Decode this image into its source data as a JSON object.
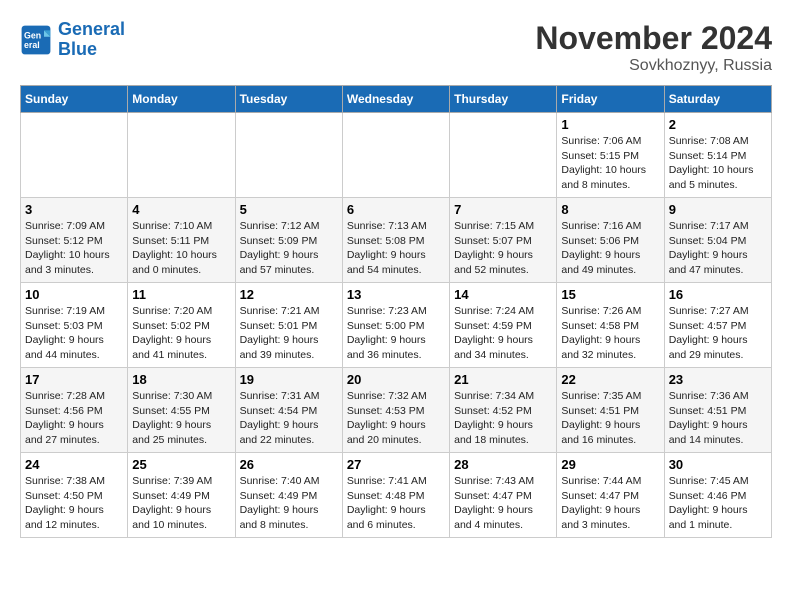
{
  "header": {
    "logo_line1": "General",
    "logo_line2": "Blue",
    "month": "November 2024",
    "location": "Sovkhoznyy, Russia"
  },
  "weekdays": [
    "Sunday",
    "Monday",
    "Tuesday",
    "Wednesday",
    "Thursday",
    "Friday",
    "Saturday"
  ],
  "weeks": [
    [
      {
        "day": "",
        "info": ""
      },
      {
        "day": "",
        "info": ""
      },
      {
        "day": "",
        "info": ""
      },
      {
        "day": "",
        "info": ""
      },
      {
        "day": "",
        "info": ""
      },
      {
        "day": "1",
        "info": "Sunrise: 7:06 AM\nSunset: 5:15 PM\nDaylight: 10 hours\nand 8 minutes."
      },
      {
        "day": "2",
        "info": "Sunrise: 7:08 AM\nSunset: 5:14 PM\nDaylight: 10 hours\nand 5 minutes."
      }
    ],
    [
      {
        "day": "3",
        "info": "Sunrise: 7:09 AM\nSunset: 5:12 PM\nDaylight: 10 hours\nand 3 minutes."
      },
      {
        "day": "4",
        "info": "Sunrise: 7:10 AM\nSunset: 5:11 PM\nDaylight: 10 hours\nand 0 minutes."
      },
      {
        "day": "5",
        "info": "Sunrise: 7:12 AM\nSunset: 5:09 PM\nDaylight: 9 hours\nand 57 minutes."
      },
      {
        "day": "6",
        "info": "Sunrise: 7:13 AM\nSunset: 5:08 PM\nDaylight: 9 hours\nand 54 minutes."
      },
      {
        "day": "7",
        "info": "Sunrise: 7:15 AM\nSunset: 5:07 PM\nDaylight: 9 hours\nand 52 minutes."
      },
      {
        "day": "8",
        "info": "Sunrise: 7:16 AM\nSunset: 5:06 PM\nDaylight: 9 hours\nand 49 minutes."
      },
      {
        "day": "9",
        "info": "Sunrise: 7:17 AM\nSunset: 5:04 PM\nDaylight: 9 hours\nand 47 minutes."
      }
    ],
    [
      {
        "day": "10",
        "info": "Sunrise: 7:19 AM\nSunset: 5:03 PM\nDaylight: 9 hours\nand 44 minutes."
      },
      {
        "day": "11",
        "info": "Sunrise: 7:20 AM\nSunset: 5:02 PM\nDaylight: 9 hours\nand 41 minutes."
      },
      {
        "day": "12",
        "info": "Sunrise: 7:21 AM\nSunset: 5:01 PM\nDaylight: 9 hours\nand 39 minutes."
      },
      {
        "day": "13",
        "info": "Sunrise: 7:23 AM\nSunset: 5:00 PM\nDaylight: 9 hours\nand 36 minutes."
      },
      {
        "day": "14",
        "info": "Sunrise: 7:24 AM\nSunset: 4:59 PM\nDaylight: 9 hours\nand 34 minutes."
      },
      {
        "day": "15",
        "info": "Sunrise: 7:26 AM\nSunset: 4:58 PM\nDaylight: 9 hours\nand 32 minutes."
      },
      {
        "day": "16",
        "info": "Sunrise: 7:27 AM\nSunset: 4:57 PM\nDaylight: 9 hours\nand 29 minutes."
      }
    ],
    [
      {
        "day": "17",
        "info": "Sunrise: 7:28 AM\nSunset: 4:56 PM\nDaylight: 9 hours\nand 27 minutes."
      },
      {
        "day": "18",
        "info": "Sunrise: 7:30 AM\nSunset: 4:55 PM\nDaylight: 9 hours\nand 25 minutes."
      },
      {
        "day": "19",
        "info": "Sunrise: 7:31 AM\nSunset: 4:54 PM\nDaylight: 9 hours\nand 22 minutes."
      },
      {
        "day": "20",
        "info": "Sunrise: 7:32 AM\nSunset: 4:53 PM\nDaylight: 9 hours\nand 20 minutes."
      },
      {
        "day": "21",
        "info": "Sunrise: 7:34 AM\nSunset: 4:52 PM\nDaylight: 9 hours\nand 18 minutes."
      },
      {
        "day": "22",
        "info": "Sunrise: 7:35 AM\nSunset: 4:51 PM\nDaylight: 9 hours\nand 16 minutes."
      },
      {
        "day": "23",
        "info": "Sunrise: 7:36 AM\nSunset: 4:51 PM\nDaylight: 9 hours\nand 14 minutes."
      }
    ],
    [
      {
        "day": "24",
        "info": "Sunrise: 7:38 AM\nSunset: 4:50 PM\nDaylight: 9 hours\nand 12 minutes."
      },
      {
        "day": "25",
        "info": "Sunrise: 7:39 AM\nSunset: 4:49 PM\nDaylight: 9 hours\nand 10 minutes."
      },
      {
        "day": "26",
        "info": "Sunrise: 7:40 AM\nSunset: 4:49 PM\nDaylight: 9 hours\nand 8 minutes."
      },
      {
        "day": "27",
        "info": "Sunrise: 7:41 AM\nSunset: 4:48 PM\nDaylight: 9 hours\nand 6 minutes."
      },
      {
        "day": "28",
        "info": "Sunrise: 7:43 AM\nSunset: 4:47 PM\nDaylight: 9 hours\nand 4 minutes."
      },
      {
        "day": "29",
        "info": "Sunrise: 7:44 AM\nSunset: 4:47 PM\nDaylight: 9 hours\nand 3 minutes."
      },
      {
        "day": "30",
        "info": "Sunrise: 7:45 AM\nSunset: 4:46 PM\nDaylight: 9 hours\nand 1 minute."
      }
    ]
  ]
}
